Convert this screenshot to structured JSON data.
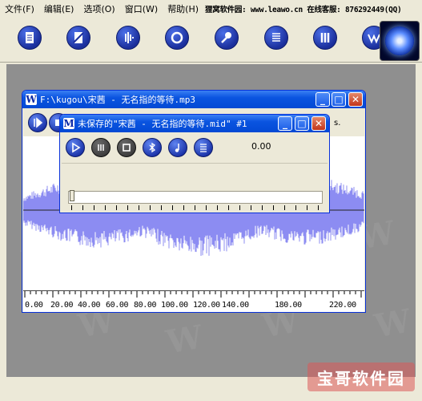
{
  "menu": [
    {
      "label": "文件(F)"
    },
    {
      "label": "编辑(E)"
    },
    {
      "label": "选项(O)"
    },
    {
      "label": "窗口(W)"
    },
    {
      "label": "帮助(H)"
    }
  ],
  "menu_info": "狸窝软件园: www.leawo.cn 在线客服: 876292449(QQ)",
  "toolbar_icons": [
    "new-document-icon",
    "no-edit-icon",
    "waveform-icon",
    "record-icon",
    "microphone-icon",
    "list-icon",
    "bars-icon",
    "wave-icon"
  ],
  "outer_window": {
    "title": "F:\\kugou\\宋茜 - 无名指的等待.mp3",
    "status_fragment": "s.",
    "timeline_labels": [
      "0.00",
      "20.00",
      "40.00",
      "60.00",
      "80.00",
      "100.00",
      "120.00",
      "140.00",
      "180.00",
      "220.00"
    ]
  },
  "inner_window": {
    "title": "未保存的\"宋茜 - 无名指的等待.mid\" #1",
    "timer": "0.00",
    "buttons": [
      "play-icon",
      "pause-icon",
      "stop-icon",
      "bluetooth-icon",
      "note-icon",
      "list-icon"
    ]
  },
  "watermark": "W",
  "badge": "宝哥软件园",
  "colors": {
    "accent": "#0a54e0",
    "wave": "#8c8cf2",
    "workspace": "#8f8f8f"
  }
}
